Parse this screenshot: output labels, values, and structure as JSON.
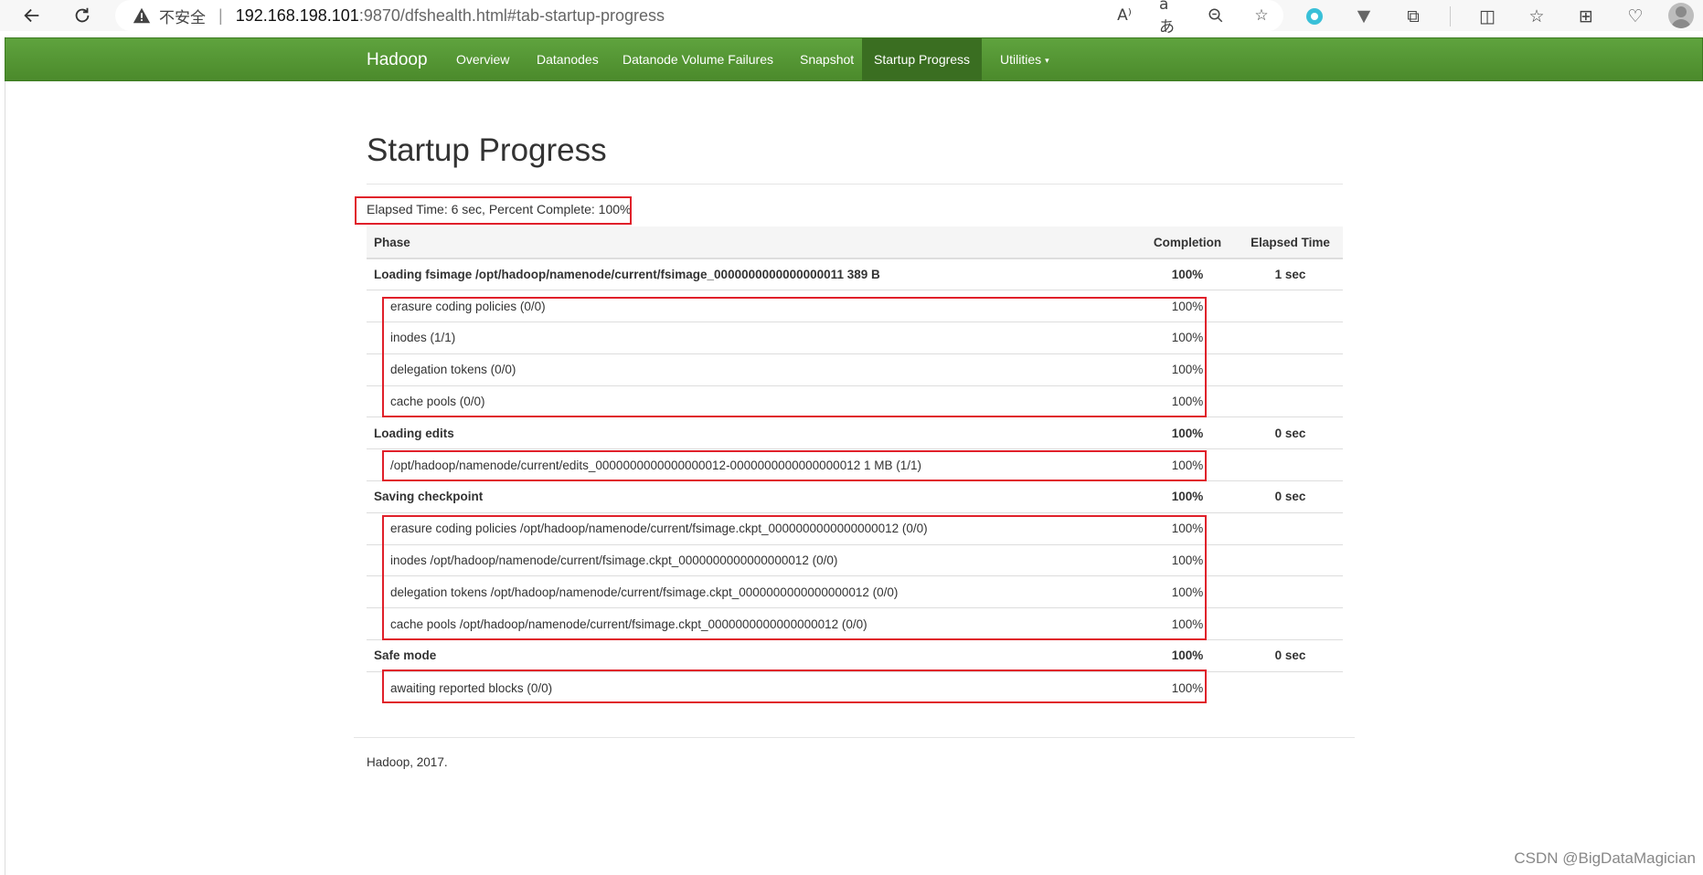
{
  "browser": {
    "security_label": "不安全",
    "url_host": "192.168.198.101",
    "url_rest": ":9870/dfshealth.html#tab-startup-progress"
  },
  "navbar": {
    "brand": "Hadoop",
    "items": [
      {
        "label": "Overview"
      },
      {
        "label": "Datanodes"
      },
      {
        "label": "Datanode Volume Failures"
      },
      {
        "label": "Snapshot"
      },
      {
        "label": "Startup Progress",
        "active": true
      },
      {
        "label": "Utilities"
      }
    ]
  },
  "page": {
    "title": "Startup Progress",
    "elapsed_summary": "Elapsed Time: 6 sec, Percent Complete: 100%"
  },
  "table": {
    "headers": {
      "phase": "Phase",
      "completion": "Completion",
      "elapsed": "Elapsed Time"
    },
    "rows": [
      {
        "kind": "phase",
        "phase": "Loading fsimage /opt/hadoop/namenode/current/fsimage_0000000000000000011 389 B",
        "completion": "100%",
        "elapsed": "1 sec"
      },
      {
        "kind": "step",
        "phase": "erasure coding policies (0/0)",
        "completion": "100%",
        "elapsed": ""
      },
      {
        "kind": "step",
        "phase": "inodes (1/1)",
        "completion": "100%",
        "elapsed": ""
      },
      {
        "kind": "step",
        "phase": "delegation tokens (0/0)",
        "completion": "100%",
        "elapsed": ""
      },
      {
        "kind": "step",
        "phase": "cache pools (0/0)",
        "completion": "100%",
        "elapsed": ""
      },
      {
        "kind": "phase",
        "phase": "Loading edits",
        "completion": "100%",
        "elapsed": "0 sec"
      },
      {
        "kind": "step",
        "phase": "/opt/hadoop/namenode/current/edits_0000000000000000012-0000000000000000012 1 MB (1/1)",
        "completion": "100%",
        "elapsed": ""
      },
      {
        "kind": "phase",
        "phase": "Saving checkpoint",
        "completion": "100%",
        "elapsed": "0 sec"
      },
      {
        "kind": "step",
        "phase": "erasure coding policies /opt/hadoop/namenode/current/fsimage.ckpt_0000000000000000012 (0/0)",
        "completion": "100%",
        "elapsed": ""
      },
      {
        "kind": "step",
        "phase": "inodes /opt/hadoop/namenode/current/fsimage.ckpt_0000000000000000012 (0/0)",
        "completion": "100%",
        "elapsed": ""
      },
      {
        "kind": "step",
        "phase": "delegation tokens /opt/hadoop/namenode/current/fsimage.ckpt_0000000000000000012 (0/0)",
        "completion": "100%",
        "elapsed": ""
      },
      {
        "kind": "step",
        "phase": "cache pools /opt/hadoop/namenode/current/fsimage.ckpt_0000000000000000012 (0/0)",
        "completion": "100%",
        "elapsed": ""
      },
      {
        "kind": "phase",
        "phase": "Safe mode",
        "completion": "100%",
        "elapsed": "0 sec"
      },
      {
        "kind": "step",
        "phase": "awaiting reported blocks (0/0)",
        "completion": "100%",
        "elapsed": ""
      }
    ]
  },
  "footer": {
    "text": "Hadoop, 2017."
  },
  "watermark": "CSDN @BigDataMagician",
  "colors": {
    "navbar": "#4f8f2f",
    "navbar_active": "#3a6e21",
    "highlight_box": "#e0202a"
  }
}
